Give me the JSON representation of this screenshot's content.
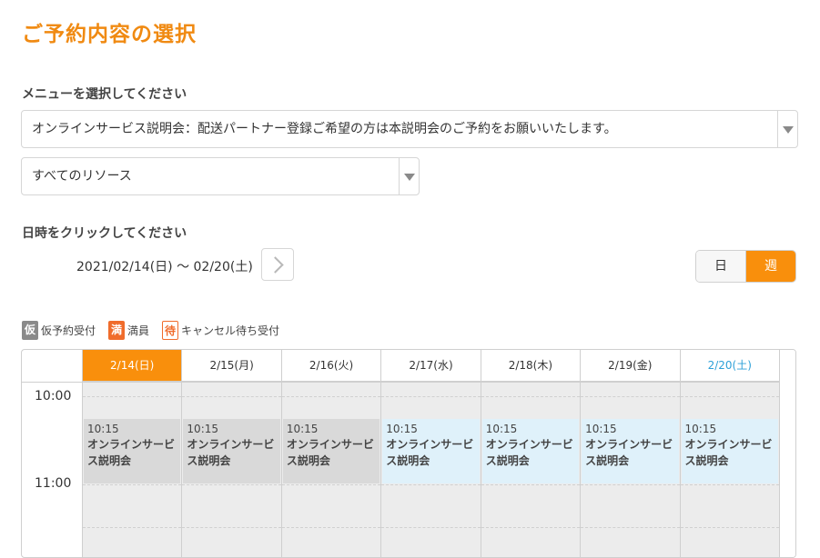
{
  "page_title": "ご予約内容の選択",
  "menu_section": {
    "label": "メニューを選択してください",
    "menu_select_value": "オンラインサービス説明会：配送パートナー登録ご希望の方は本説明会のご予約をお願いいたします。",
    "resource_select_value": "すべてのリソース"
  },
  "date_section": {
    "label": "日時をクリックしてください",
    "range": "2021/02/14(日) 〜 02/20(土)"
  },
  "view_toggle": {
    "day": "日",
    "week": "週",
    "selected": "週"
  },
  "legend": [
    {
      "badge": "仮",
      "text": "仮予約受付"
    },
    {
      "badge": "満",
      "text": "満員"
    },
    {
      "badge": "待",
      "text": "キャンセル待ち受付"
    }
  ],
  "calendar": {
    "times": [
      "10:00",
      "11:00"
    ],
    "days": [
      {
        "label": "2/14(日)",
        "event": {
          "time": "10:15",
          "title": "オンラインサービス説明会",
          "status": "closed"
        }
      },
      {
        "label": "2/15(月)",
        "event": {
          "time": "10:15",
          "title": "オンラインサービス説明会",
          "status": "closed"
        }
      },
      {
        "label": "2/16(火)",
        "event": {
          "time": "10:15",
          "title": "オンラインサービス説明会",
          "status": "closed"
        }
      },
      {
        "label": "2/17(水)",
        "event": {
          "time": "10:15",
          "title": "オンラインサービス説明会",
          "status": "open"
        }
      },
      {
        "label": "2/18(木)",
        "event": {
          "time": "10:15",
          "title": "オンラインサービス説明会",
          "status": "open"
        }
      },
      {
        "label": "2/19(金)",
        "event": {
          "time": "10:15",
          "title": "オンラインサービス説明会",
          "status": "open"
        }
      },
      {
        "label": "2/20(土)",
        "event": {
          "time": "10:15",
          "title": "オンラインサービス説明会",
          "status": "open"
        }
      }
    ]
  },
  "colors": {
    "accent": "#f98f0c",
    "title": "#f08a12",
    "saturday": "#2da0d8",
    "event_closed": "#d9d9d9",
    "event_open": "#dff1fa"
  }
}
